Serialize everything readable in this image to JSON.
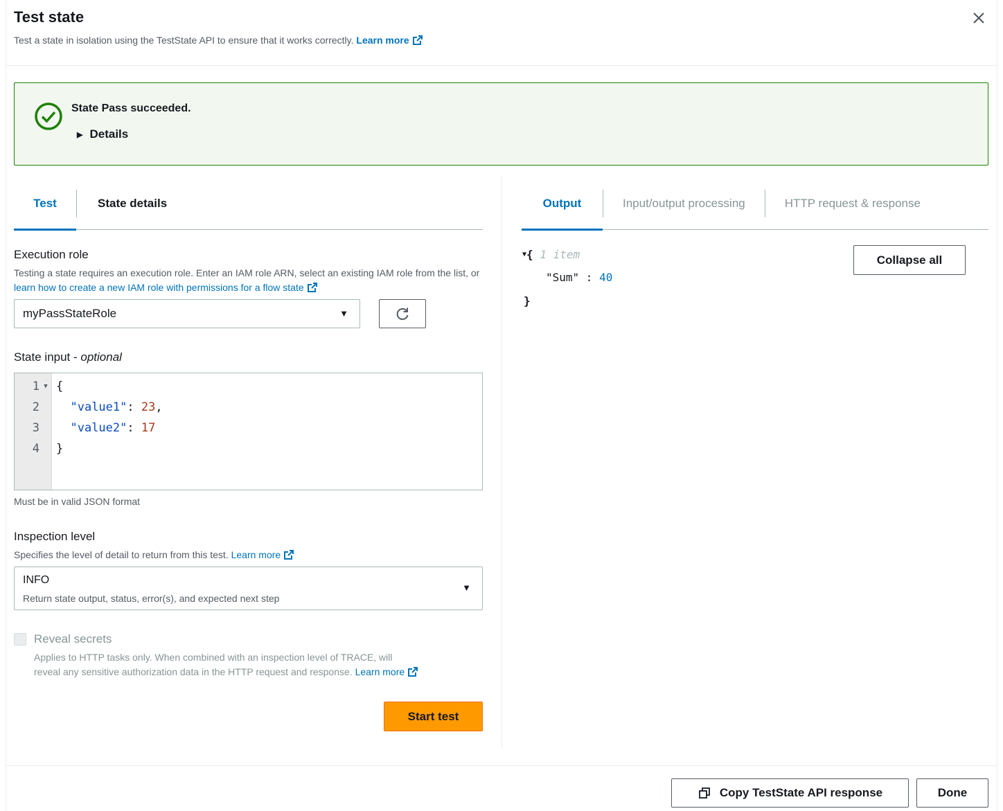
{
  "modal": {
    "title": "Test state",
    "subtitle": "Test a state in isolation using the TestState API to ensure that it works correctly.",
    "subtitle_link": "Learn more"
  },
  "alert": {
    "title": "State Pass succeeded.",
    "details_label": "Details",
    "status_color": "#1d8102"
  },
  "left_tabs": [
    {
      "label": "Test",
      "active": true
    },
    {
      "label": "State details",
      "active": false
    }
  ],
  "execution_role": {
    "label": "Execution role",
    "desc_prefix": "Testing a state requires an execution role. Enter an IAM role ARN, select an existing IAM role from the list, or ",
    "desc_link": "learn how to create a new IAM role with permissions for a flow state",
    "value": "myPassStateRole"
  },
  "state_input": {
    "label": "State input - ",
    "label_italic": "optional",
    "lines": [
      {
        "n": "1",
        "text": "{"
      },
      {
        "n": "2",
        "key": "\"value1\"",
        "value": "23",
        "trail": ","
      },
      {
        "n": "3",
        "key": "\"value2\"",
        "value": "17",
        "trail": ""
      },
      {
        "n": "4",
        "text": "}"
      }
    ],
    "hint": "Must be in valid JSON format"
  },
  "inspection_level": {
    "label": "Inspection level",
    "desc": "Specifies the level of detail to return from this test.",
    "desc_link": "Learn more",
    "value": "INFO",
    "value_desc": "Return state output, status, error(s), and expected next step"
  },
  "reveal_secrets": {
    "label": "Reveal secrets",
    "desc_line1": "Applies to HTTP tasks only. When combined with an inspection level of TRACE, will",
    "desc_line2": "reveal any sensitive authorization data in the HTTP request and response.",
    "desc_link": "Learn more"
  },
  "start_test_label": "Start test",
  "right_tabs": [
    {
      "label": "Output",
      "active": true
    },
    {
      "label": "Input/output processing",
      "active": false
    },
    {
      "label": "HTTP request & response",
      "active": false
    }
  ],
  "output": {
    "open_brace": "{",
    "meta": "1 item",
    "key": "\"Sum\"",
    "colon": " : ",
    "value": "40",
    "close_brace": "}",
    "collapse_all_label": "Collapse all"
  },
  "footer": {
    "copy_label": "Copy TestState API response",
    "done_label": "Done"
  },
  "colors": {
    "primary_button": "#ff9900",
    "link": "#0073bb",
    "success": "#1d8102"
  }
}
